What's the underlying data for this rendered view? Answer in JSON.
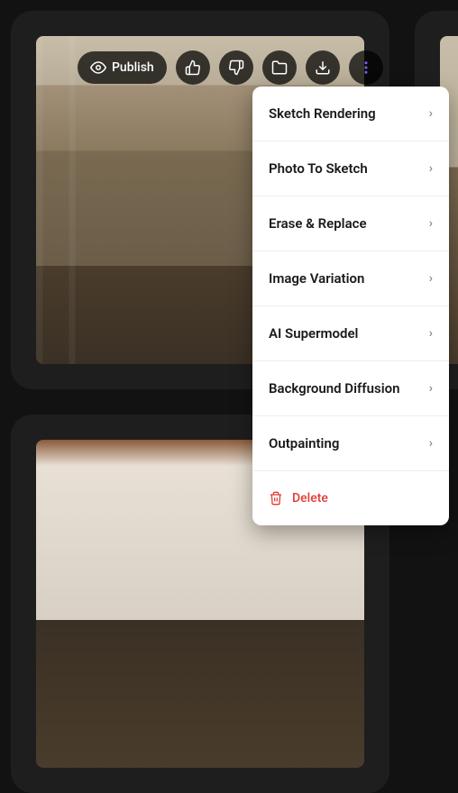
{
  "toolbar": {
    "publish_label": "Publish"
  },
  "menu": {
    "items": [
      {
        "label": "Sketch Rendering"
      },
      {
        "label": "Photo To Sketch"
      },
      {
        "label": "Erase & Replace"
      },
      {
        "label": "Image Variation"
      },
      {
        "label": "AI Supermodel"
      },
      {
        "label": "Background Diffusion"
      },
      {
        "label": "Outpainting"
      }
    ],
    "delete_label": "Delete"
  }
}
